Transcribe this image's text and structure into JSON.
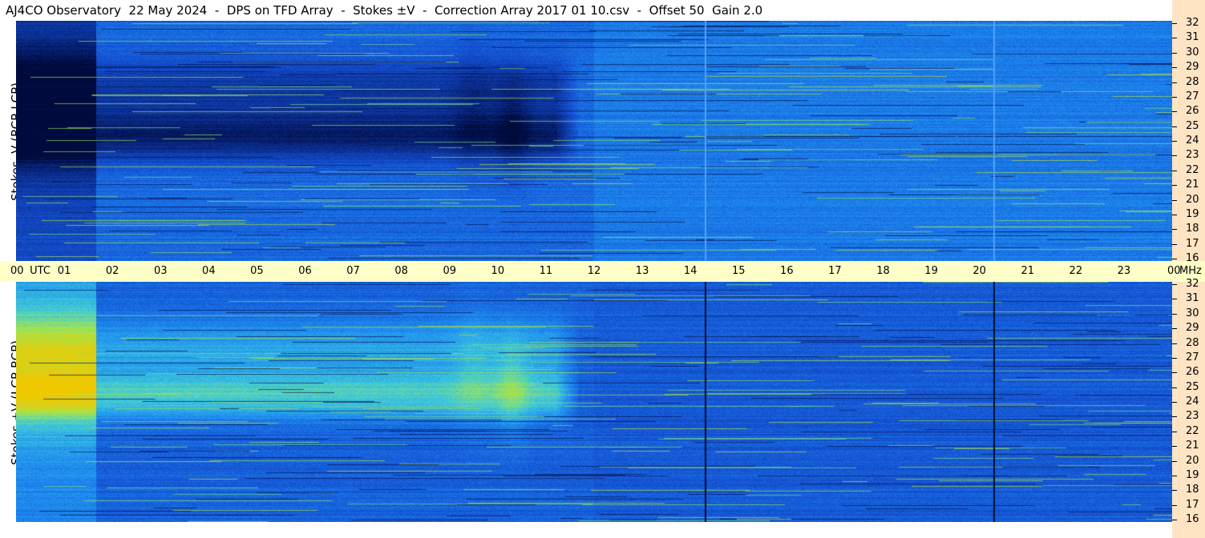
{
  "title": "AJ4CO Observatory  22 May 2024  -  DPS on TFD Array  -  Stokes ±V  -  Correction Array 2017 01 10.csv  -  Offset 50  Gain 2.0",
  "chart_data": [
    {
      "type": "heatmap",
      "ylabel": "Stokes -V (RCP-LCP)",
      "x_range_utc_hours": [
        0,
        24
      ],
      "y_range_mhz": [
        16,
        32
      ],
      "y_ticks": [
        "32",
        "31",
        "30",
        "29",
        "28",
        "27",
        "26",
        "25",
        "24",
        "23",
        "22",
        "21",
        "20",
        "19",
        "18",
        "17",
        "16"
      ],
      "colormap": [
        "#000a3c",
        "#0a2c8c",
        "#1450d2",
        "#1e8cf0",
        "#3cc8dc",
        "#a0e650",
        "#f0c800"
      ],
      "vertical_lines_utc": [
        14.3,
        20.3
      ],
      "vertical_line_color": "#50a0ff"
    },
    {
      "type": "heatmap",
      "ylabel": "Stokes +V (LCP-RCP)",
      "x_range_utc_hours": [
        0,
        24
      ],
      "y_range_mhz": [
        16,
        32
      ],
      "y_ticks": [
        "32",
        "31",
        "30",
        "29",
        "28",
        "27",
        "26",
        "25",
        "24",
        "23",
        "22",
        "21",
        "20",
        "19",
        "18",
        "17",
        "16"
      ],
      "colormap": [
        "#000a3c",
        "#0a2c8c",
        "#1450d2",
        "#1e8cf0",
        "#3cc8dc",
        "#a0e650",
        "#f0c800"
      ],
      "vertical_lines_utc": [
        14.3,
        20.3
      ],
      "vertical_line_color": "#001030"
    }
  ],
  "time_axis": {
    "unit_label": "UTC",
    "ticks": [
      "00",
      "01",
      "02",
      "03",
      "04",
      "05",
      "06",
      "07",
      "08",
      "09",
      "10",
      "11",
      "12",
      "13",
      "14",
      "15",
      "16",
      "17",
      "18",
      "19",
      "20",
      "21",
      "22",
      "23",
      "00"
    ],
    "freq_unit": "MHz"
  },
  "colors": {
    "axis_bg_time": "#ffffc8",
    "axis_bg_freq": "#ffe4c4"
  }
}
